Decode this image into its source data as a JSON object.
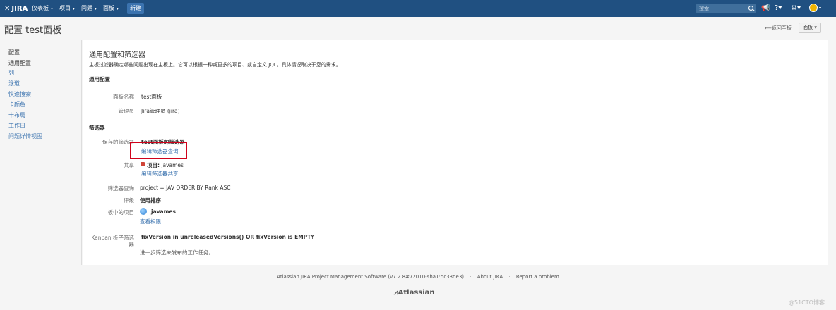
{
  "nav": {
    "logo": "JIRA",
    "items": [
      {
        "label": "仪表板"
      },
      {
        "label": "项目"
      },
      {
        "label": "问题"
      },
      {
        "label": "面板"
      }
    ],
    "create": "新建",
    "search_placeholder": "搜索",
    "icons": [
      "search-icon",
      "notification-icon",
      "help-icon",
      "settings-icon",
      "user-avatar"
    ]
  },
  "header": {
    "title": "配置 test面板",
    "back": "返回至板",
    "board_button": "面板"
  },
  "sidebar": {
    "heading": "配置",
    "items": [
      {
        "label": "通用配置",
        "active": true
      },
      {
        "label": "列"
      },
      {
        "label": "泳道"
      },
      {
        "label": "快速搜索"
      },
      {
        "label": "卡颜色"
      },
      {
        "label": "卡布局"
      },
      {
        "label": "工作日"
      },
      {
        "label": "问题详情视图"
      }
    ]
  },
  "main": {
    "title": "通用配置和筛选器",
    "description": "主板过滤器确定哪些问题出现在主板上。它可以根据一种或更多的项目、或自定义 JQL。具体情况取决于您的需求。",
    "general_section": "通用配置",
    "board_name_label": "面板名称",
    "board_name": "test面板",
    "admin_label": "管理员",
    "admin": "Jira管理员 (jira)",
    "filter_section": "筛选器",
    "saved_filter_label": "保存的筛选器",
    "saved_filter": "test面板的筛选器",
    "edit_filter_query": "编辑筛选器查询",
    "share_label": "共享",
    "share_prefix": "项目:",
    "share_value": "javames",
    "edit_filter_share": "编辑筛选器共享",
    "filter_query_label": "筛选器查询",
    "filter_query": "project = JAV ORDER BY Rank ASC",
    "rank_label": "评级",
    "rank_value": "使用排序",
    "projects_label": "板中的项目",
    "project_name": "javames",
    "view_permissions": "查看权限",
    "kanban_label_1": "Kanban 板子筛选",
    "kanban_label_2": "器",
    "kanban_filter": "fixVersion in unreleasedVersions() OR fixVersion is EMPTY",
    "kanban_hint": "进一步筛选未发布的工作任务。"
  },
  "footer": {
    "software": "Atlassian JIRA Project Management Software (v7.2.8#72010-sha1:dc33de3)",
    "about": "About JIRA",
    "report": "Report a problem",
    "brand": "Atlassian",
    "watermark": "@51CTO博客"
  },
  "colors": {
    "nav_bg": "#205081",
    "link": "#3b73af",
    "highlight_box": "#d0021b"
  }
}
